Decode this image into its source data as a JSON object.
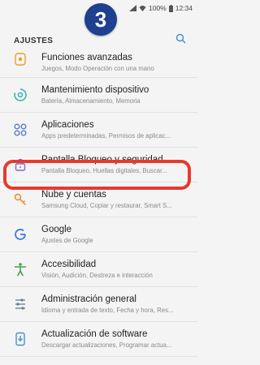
{
  "status_bar": {
    "battery": "100%",
    "time": "12:34",
    "icons": [
      "signal-icon",
      "wifi-icon",
      "battery-icon"
    ]
  },
  "step_badge": {
    "number": "3",
    "color": "#1f3f8f"
  },
  "header": {
    "title": "AJUSTES",
    "search_icon": "search-icon"
  },
  "settings": [
    {
      "title": "Funciones avanzadas",
      "subtitle": "Juegos, Modo Operación con una mano",
      "icon": "advanced-features-icon",
      "color": "#f0a020"
    },
    {
      "title": "Mantenimiento dispositivo",
      "subtitle": "Batería, Almacenamiento, Memoria",
      "icon": "device-maintenance-icon",
      "color": "#29b6a8"
    },
    {
      "title": "Aplicaciones",
      "subtitle": "Apps predeterminadas, Permisos de aplicac...",
      "icon": "apps-icon",
      "color": "#5c7bd9"
    },
    {
      "title": "Pantalla Bloqueo y seguridad",
      "subtitle": "Pantalla Bloqueo, Huellas digitales, Buscar...",
      "icon": "lock-icon",
      "color": "#7e6bd0"
    },
    {
      "title": "Nube y cuentas",
      "subtitle": "Samsung Cloud, Copiar y restaurar, Smart S...",
      "icon": "key-icon",
      "color": "#f08a24"
    },
    {
      "title": "Google",
      "subtitle": "Ajustes de Google",
      "icon": "google-icon",
      "color": "#3b7be8"
    },
    {
      "title": "Accesibilidad",
      "subtitle": "Visión, Audición, Destreza e interacción",
      "icon": "accessibility-icon",
      "color": "#3aa64a"
    },
    {
      "title": "Administración general",
      "subtitle": "Idioma y entrada de texto, Fecha y hora, Res...",
      "icon": "general-management-icon",
      "color": "#5f7d9c"
    },
    {
      "title": "Actualización de software",
      "subtitle": "Descargar actualizaciones, Programar actua...",
      "icon": "software-update-icon",
      "color": "#4a8fd0"
    }
  ],
  "highlight_color": "#e8392e"
}
